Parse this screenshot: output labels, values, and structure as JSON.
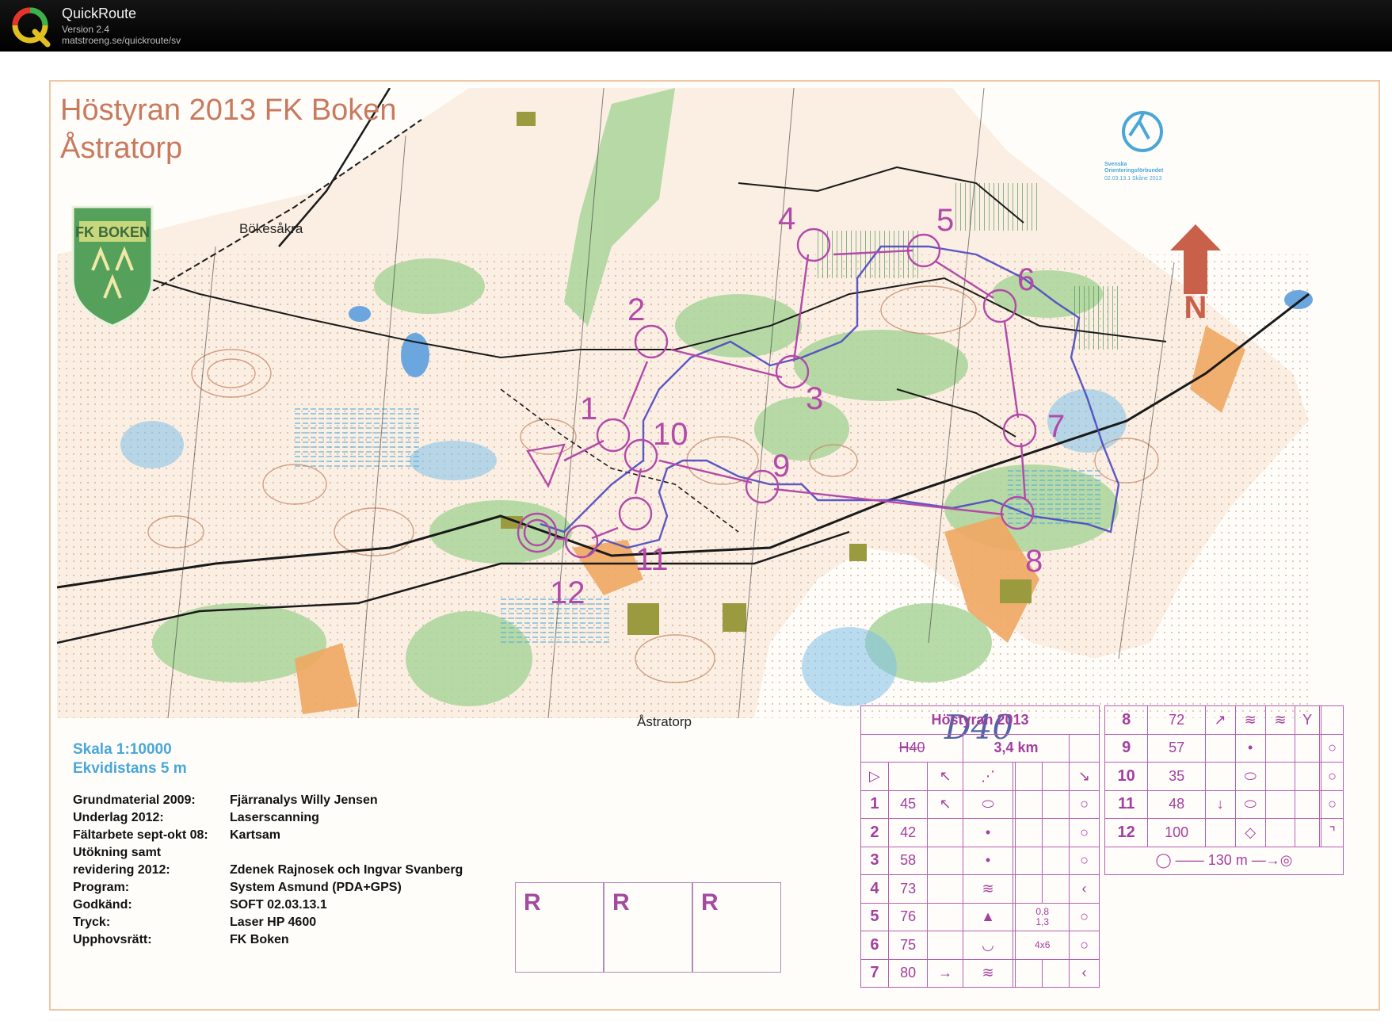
{
  "app": {
    "title": "QuickRoute",
    "version": "Version 2.4",
    "url": "matstroeng.se/quickroute/sv"
  },
  "map": {
    "title_line1": "Höstyran 2013 FK Boken",
    "title_line2": "Åstratorp",
    "club_badge_text": "FK BOKEN",
    "place_bokesakra": "Bökesåkra",
    "place_astratorp": "Åstratorp",
    "north_label": "N",
    "colors": {
      "course": "#b349a8",
      "route": "#4b47c0",
      "title": "#c87a5f",
      "scale_text": "#49a7d8"
    },
    "controls": [
      {
        "n": "1"
      },
      {
        "n": "2"
      },
      {
        "n": "3"
      },
      {
        "n": "4"
      },
      {
        "n": "5"
      },
      {
        "n": "6"
      },
      {
        "n": "7"
      },
      {
        "n": "8"
      },
      {
        "n": "9"
      },
      {
        "n": "10"
      },
      {
        "n": "11"
      },
      {
        "n": "12"
      }
    ]
  },
  "legend": {
    "scale": "Skala 1:10000",
    "contour": "Ekvidistans 5 m",
    "rows": [
      {
        "k": "Grundmaterial 2009:",
        "v": "Fjärranalys Willy Jensen"
      },
      {
        "k": "Underlag 2012:",
        "v": "Laserscanning"
      },
      {
        "k": "Fältarbete sept-okt 08:",
        "v": "Kartsam"
      },
      {
        "k": "Utökning samt",
        "v": ""
      },
      {
        "k": "revidering 2012:",
        "v": "Zdenek Rajnosek och Ingvar Svanberg"
      },
      {
        "k": "Program:",
        "v": "System Asmund (PDA+GPS)"
      },
      {
        "k": "Godkänd:",
        "v": "SOFT 02.03.13.1"
      },
      {
        "k": "Tryck:",
        "v": "Laser HP 4600"
      },
      {
        "k": "Upphovsrätt:",
        "v": "FK Boken"
      }
    ],
    "r_boxes": [
      "R",
      "R",
      "R"
    ]
  },
  "sof_logo": {
    "line1": "Svenska",
    "line2": "Orienteringsförbundet",
    "line3": "02.03.13.1   Skåne 2013"
  },
  "handwriting": "D40",
  "descriptions": {
    "event": "Höstyran 2013",
    "class": "H40",
    "length": "3,4 km",
    "left": [
      {
        "n": "1",
        "code": "45"
      },
      {
        "n": "2",
        "code": "42"
      },
      {
        "n": "3",
        "code": "58"
      },
      {
        "n": "4",
        "code": "73"
      },
      {
        "n": "5",
        "code": "76"
      },
      {
        "n": "6",
        "code": "75"
      },
      {
        "n": "7",
        "code": "80"
      }
    ],
    "right": [
      {
        "n": "8",
        "code": "72"
      },
      {
        "n": "9",
        "code": "57"
      },
      {
        "n": "10",
        "code": "35"
      },
      {
        "n": "11",
        "code": "48"
      },
      {
        "n": "12",
        "code": "100"
      }
    ],
    "dim_top": "0,8",
    "dim_bottom": "1,3",
    "size": "4x6",
    "finish": "130 m"
  }
}
